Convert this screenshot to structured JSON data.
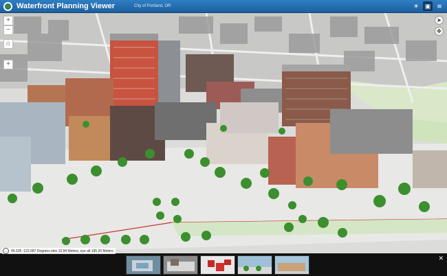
{
  "header": {
    "title": "Waterfront Planning Viewer",
    "subtitle": "City of Portland, OR",
    "tools": [
      {
        "name": "daylight-icon",
        "glyph": "☀"
      },
      {
        "name": "slides-icon",
        "glyph": "▣"
      },
      {
        "name": "layers-icon",
        "glyph": "≋"
      }
    ]
  },
  "nav": {
    "zoom_in": "+",
    "zoom_out": "−",
    "home": "⌂",
    "add": "+"
  },
  "coords": {
    "text": "45.535 -122.687 Degrees  elev 10.94 Meters,  eye alt 195.20 Meters"
  },
  "footer": {
    "close": "✕",
    "slide_count": 5
  },
  "colors": {
    "header_bg": "#1d5f9e",
    "ground": "#e6e6e4",
    "road": "#cfcfcf",
    "tree": "#3c8f2e",
    "parcel_line": "#c0392b"
  }
}
